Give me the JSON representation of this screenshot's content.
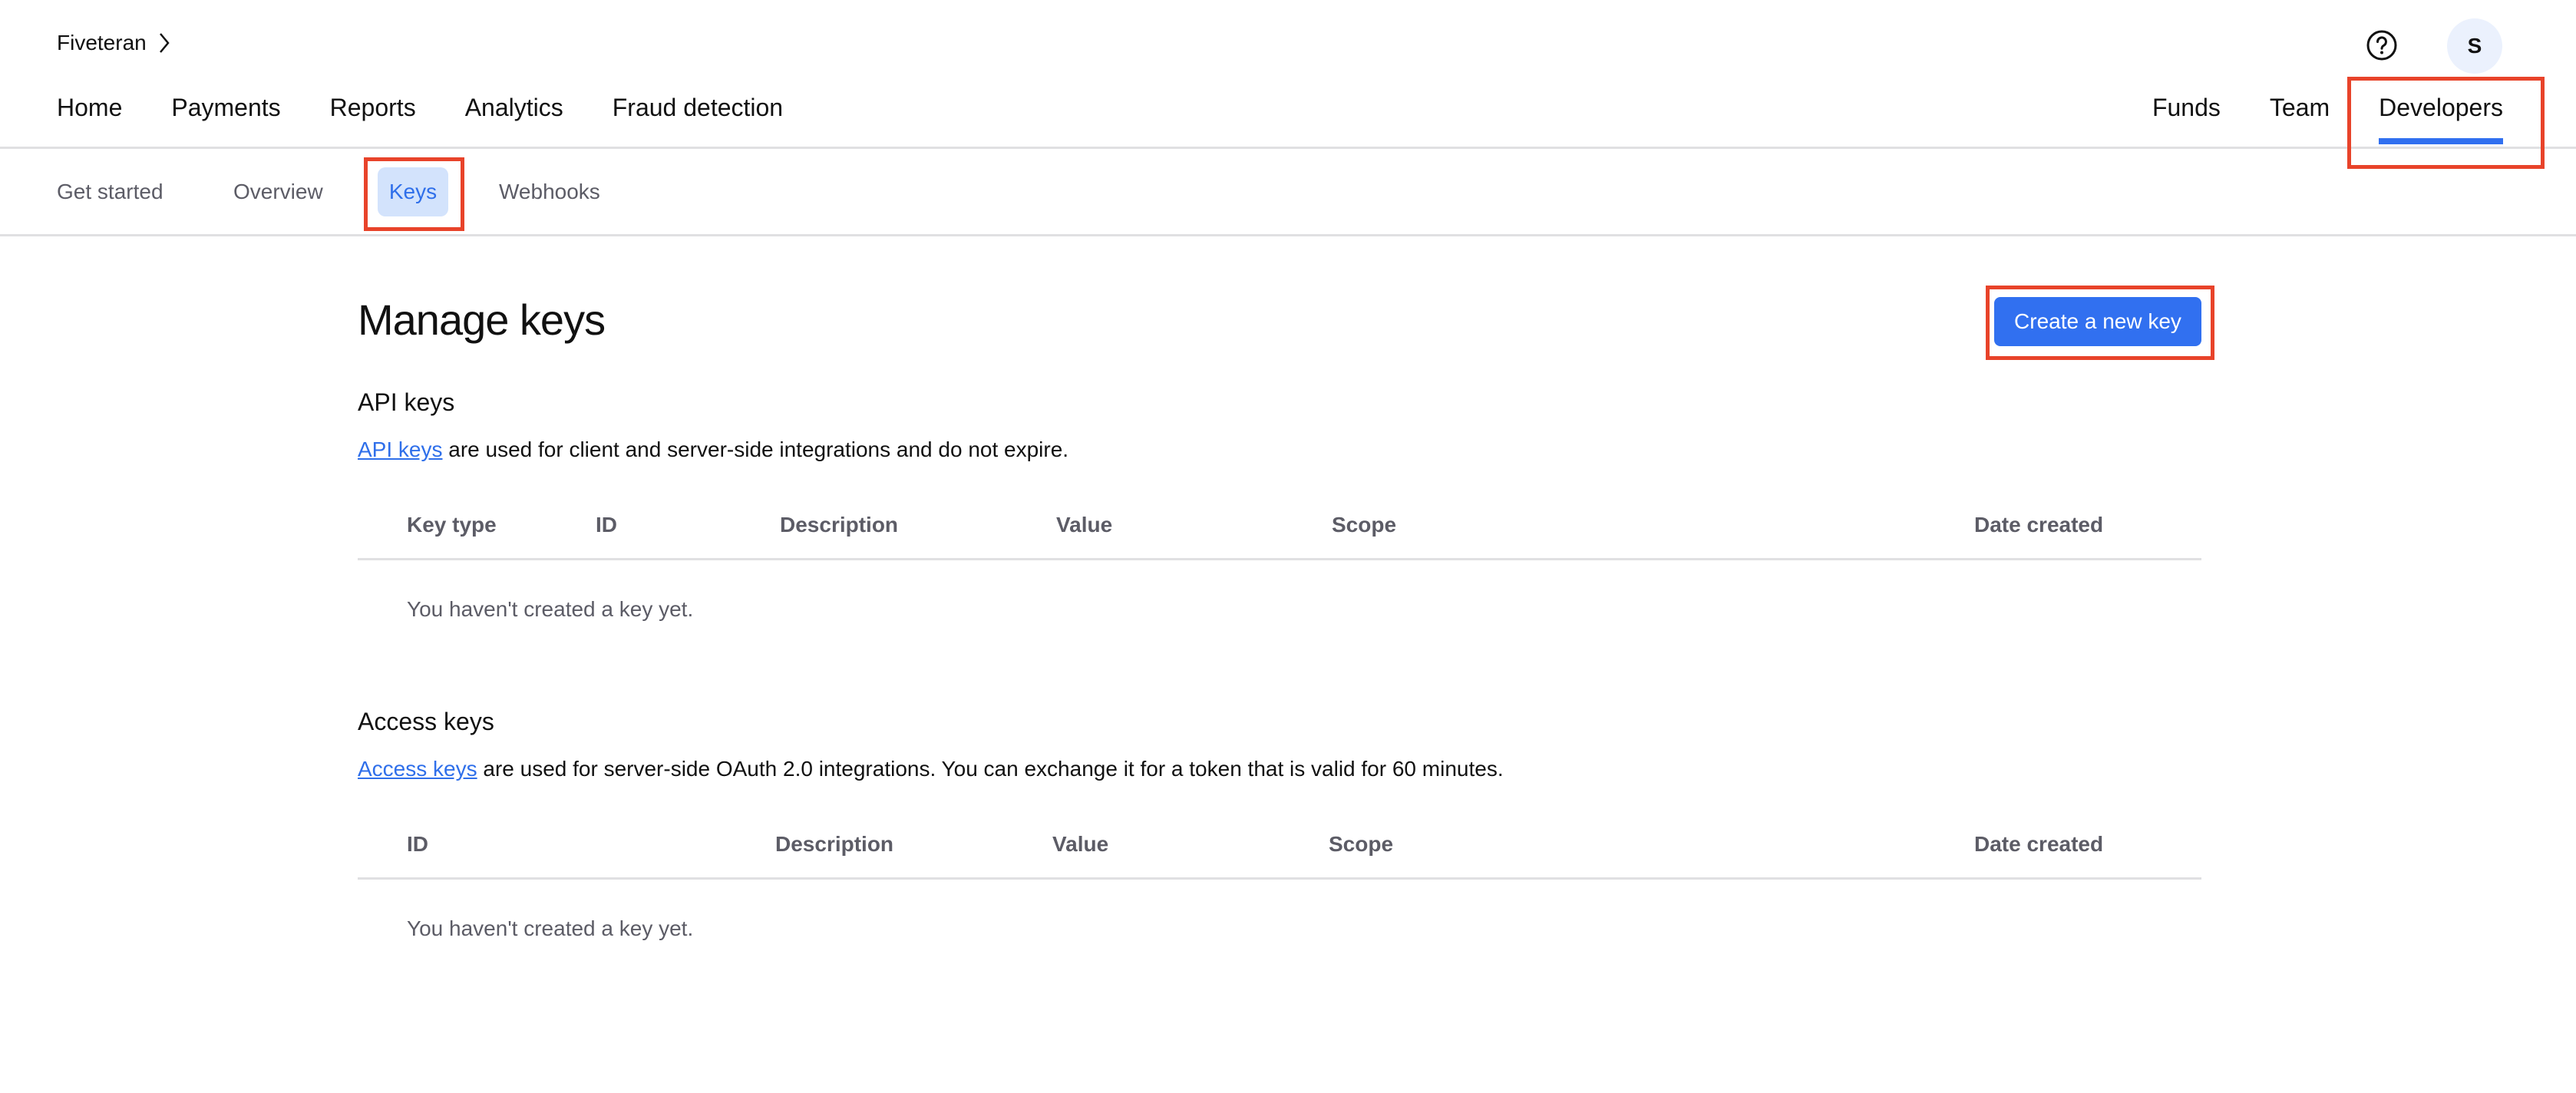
{
  "header": {
    "org_name": "Fiveteran",
    "avatar_initial": "S",
    "primary_nav_left": [
      "Home",
      "Payments",
      "Reports",
      "Analytics",
      "Fraud detection"
    ],
    "primary_nav_right": [
      "Funds",
      "Team",
      "Developers"
    ],
    "active_nav": "Developers"
  },
  "subnav": {
    "items": [
      "Get started",
      "Overview",
      "Keys",
      "Webhooks"
    ],
    "active": "Keys"
  },
  "page": {
    "title": "Manage keys",
    "create_button": "Create a new key"
  },
  "api_keys": {
    "title": "API keys",
    "link_text": "API keys",
    "description": " are used for client and server-side integrations and do not expire.",
    "columns": [
      "Key type",
      "ID",
      "Description",
      "Value",
      "Scope",
      "Date created"
    ],
    "empty_message": "You haven't created a key yet."
  },
  "access_keys": {
    "title": "Access keys",
    "link_text": "Access keys",
    "description": " are used for server-side OAuth 2.0 integrations. You can exchange it for a token that is valid for 60 minutes.",
    "columns": [
      "ID",
      "Description",
      "Value",
      "Scope",
      "Date created"
    ],
    "empty_message": "You haven't created a key yet."
  },
  "colors": {
    "accent": "#3170f0",
    "active_tab_bg": "#d3e3fc",
    "annotation": "#e8432a",
    "muted_text": "#5c5c66"
  }
}
